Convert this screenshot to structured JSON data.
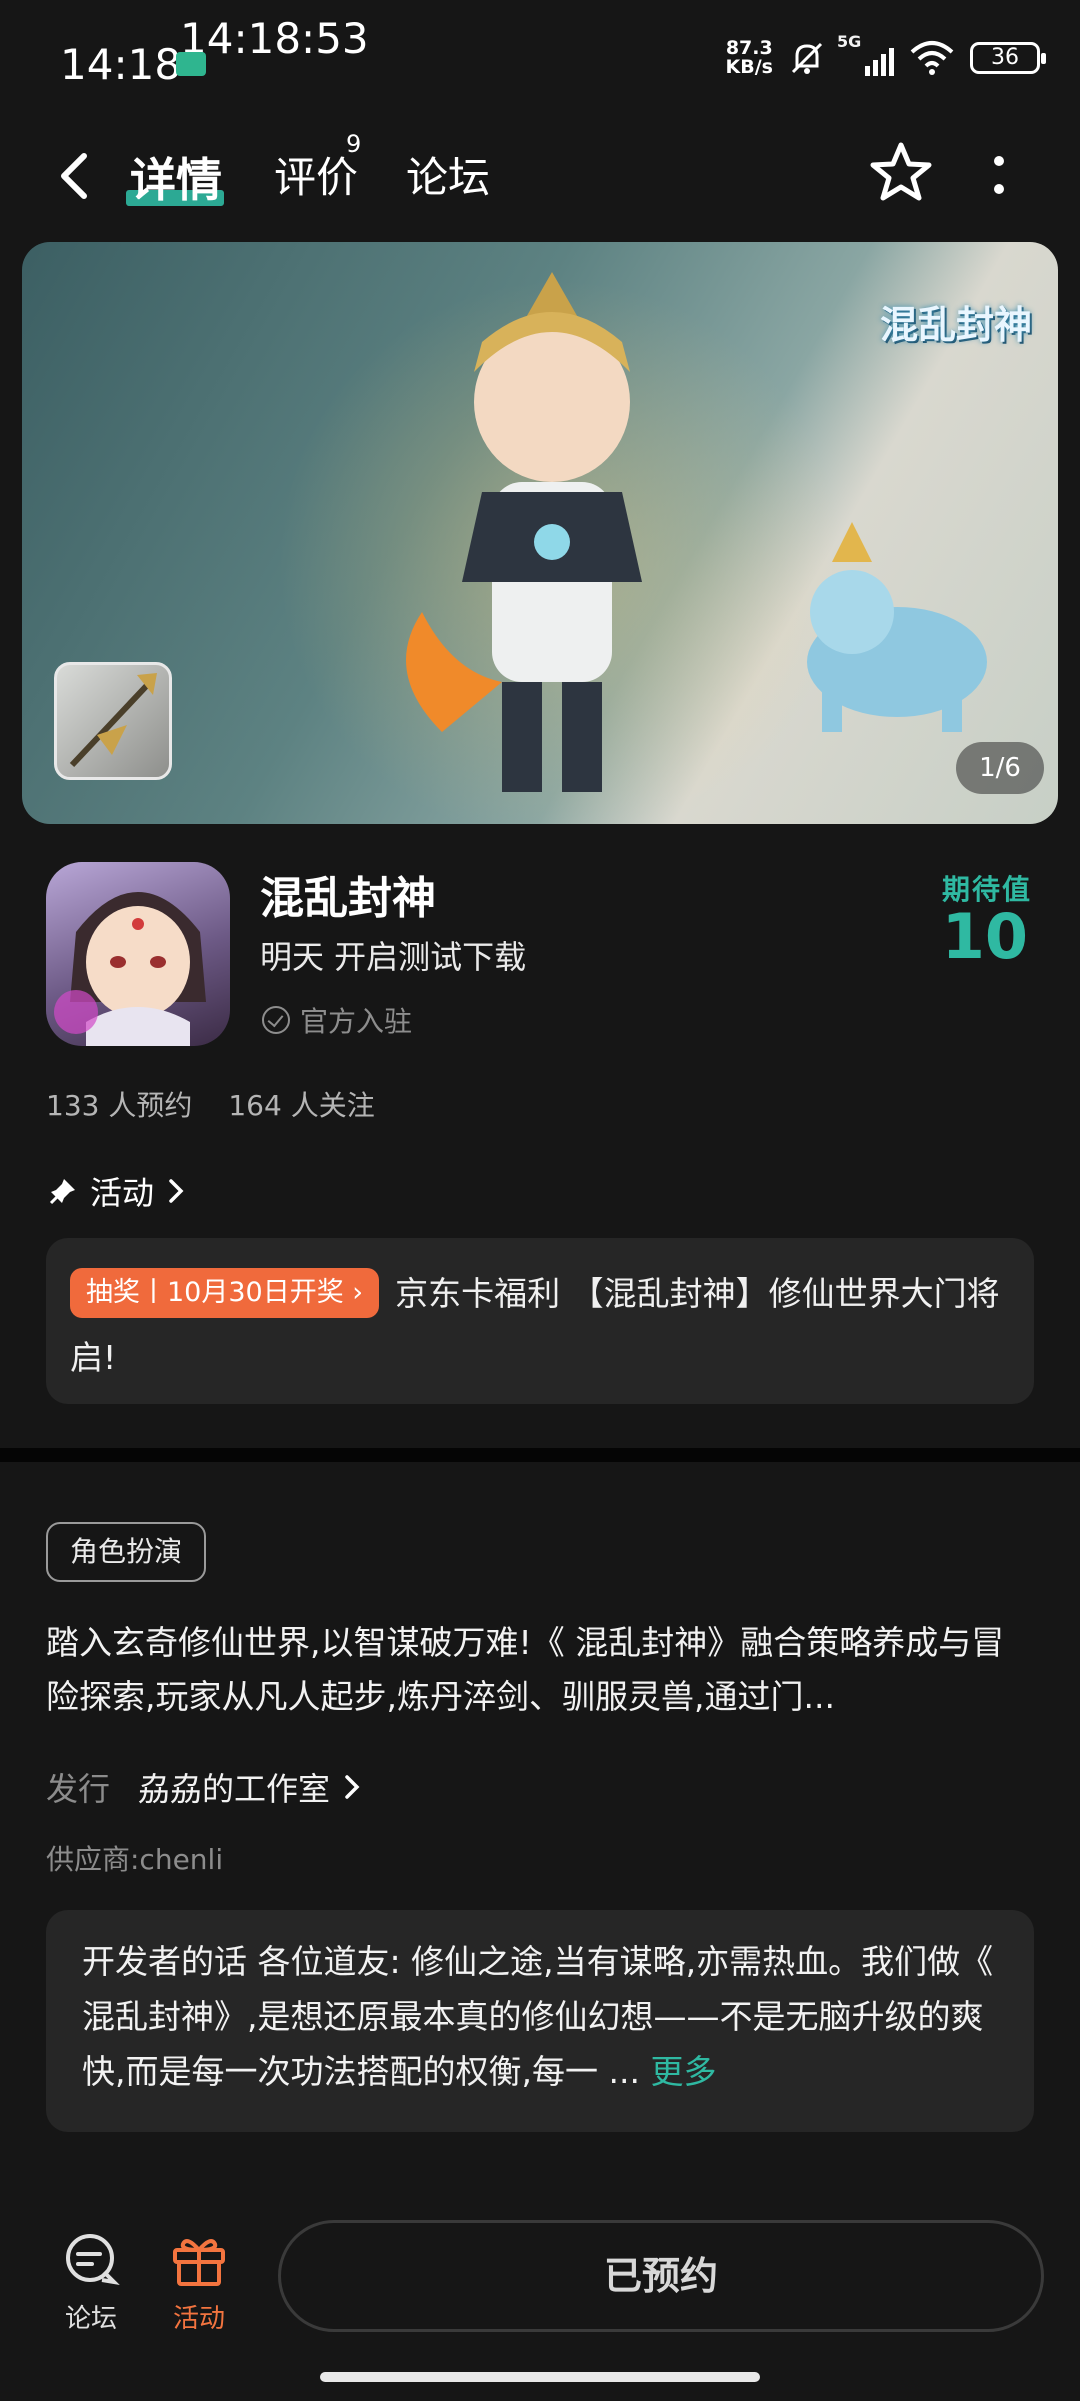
{
  "status_bar": {
    "time": "14:18",
    "clock_overlay": "14:18:53",
    "network_speed_value": "87.3",
    "network_speed_unit": "KB/s",
    "signal_label": "5G",
    "battery": "36"
  },
  "nav": {
    "tabs": [
      {
        "label": "详情"
      },
      {
        "label": "评价"
      },
      {
        "label": "论坛"
      }
    ],
    "review_count": "9"
  },
  "banner": {
    "logo_text": "混乱封神",
    "counter": "1/6"
  },
  "app": {
    "name": "混乱封神",
    "status": "明天 开启测试下载",
    "official": "官方入驻",
    "expect_label": "期待值",
    "expect_value": "10",
    "reservations": "133 人预约",
    "followers": "164 人关注"
  },
  "activity": {
    "heading": "活动",
    "tag": "抽奖丨10月30日开奖",
    "text": "京东卡福利 【混乱封神】修仙世界大门将启!"
  },
  "detail": {
    "genre_tag": "角色扮演",
    "description": "踏入玄奇修仙世界,以智谋破万难!《 混乱封神》融合策略养成与冒险探索,玩家从凡人起步,炼丹淬剑、驯服灵兽,通过门...",
    "publisher_label": "发行",
    "publisher_name": "劦劦的工作室",
    "supplier": "供应商:chenli",
    "dev_words": "开发者的话 各位道友: 修仙之途,当有谋略,亦需热血。我们做《 混乱封神》,是想还原最本真的修仙幻想——不是无脑升级的爽快,而是每一次功法搭配的权衡,每一 ...",
    "more": "更多"
  },
  "bottom_bar": {
    "forum_label": "论坛",
    "activity_label": "活动",
    "reserved_label": "已预约"
  },
  "colors": {
    "accent": "#2fb9a2",
    "orange": "#f06a3c",
    "background": "#161616",
    "card": "#262626"
  }
}
